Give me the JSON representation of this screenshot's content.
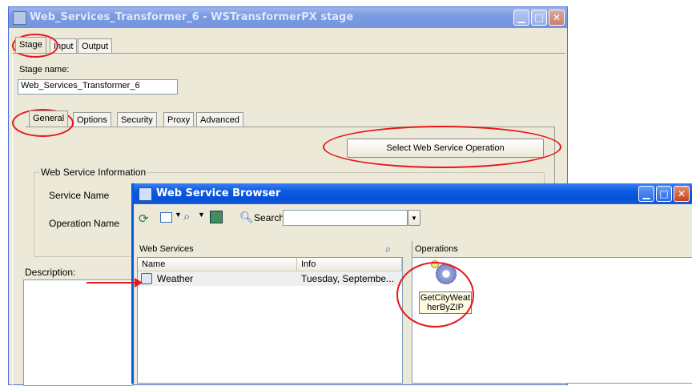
{
  "stage_window": {
    "title": "Web_Services_Transformer_6 - WSTransformerPX stage",
    "top_tabs": [
      "Stage",
      "Input",
      "Output"
    ],
    "stage_name_label": "Stage name:",
    "stage_name_value": "Web_Services_Transformer_6",
    "sub_tabs": [
      "General",
      "Options",
      "Security",
      "Proxy",
      "Advanced"
    ],
    "select_operation_button": "Select Web Service Operation",
    "group_label": "Web Service Information",
    "service_name_label": "Service Name",
    "operation_name_label": "Operation Name",
    "description_label": "Description:"
  },
  "browser_window": {
    "title": "Web Service Browser",
    "search_label": "Search:",
    "search_value": "",
    "services_panel_title": "Web Services",
    "columns": [
      "Name",
      "Info"
    ],
    "rows": [
      {
        "name": "Weather",
        "info": "Tuesday, Septembe..."
      }
    ],
    "operations_panel_title": "Operations",
    "operation_icon_label": "GetCityWeatherByZIP"
  },
  "colors": {
    "highlight_red": "#e8151b",
    "xp_blue": "#0a5ae0",
    "dialog_bg": "#ece9d8"
  },
  "icons": [
    "app-icon",
    "minimize-icon",
    "maximize-icon",
    "close-icon",
    "refresh-icon",
    "view-icon",
    "find-icon",
    "export-icon",
    "search-icon",
    "web-service-icon",
    "operation-gear-icon"
  ]
}
